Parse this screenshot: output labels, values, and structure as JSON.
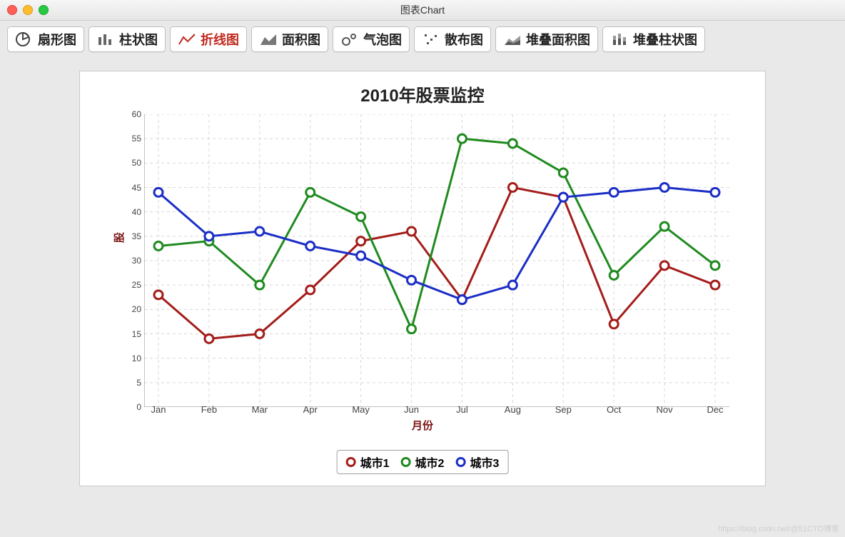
{
  "window": {
    "title": "图表Chart"
  },
  "toolbar": [
    {
      "label": "扇形图",
      "active": false
    },
    {
      "label": "柱状图",
      "active": false
    },
    {
      "label": "折线图",
      "active": true
    },
    {
      "label": "面积图",
      "active": false
    },
    {
      "label": "气泡图",
      "active": false
    },
    {
      "label": "散布图",
      "active": false
    },
    {
      "label": "堆叠面积图",
      "active": false
    },
    {
      "label": "堆叠柱状图",
      "active": false
    }
  ],
  "watermark": "https://blog.csdn.net/@51CTO博客",
  "chart_data": {
    "type": "line",
    "title": "2010年股票监控",
    "xlabel": "月份",
    "ylabel": "股",
    "categories": [
      "Jan",
      "Feb",
      "Mar",
      "Apr",
      "May",
      "Jun",
      "Jul",
      "Aug",
      "Sep",
      "Oct",
      "Nov",
      "Dec"
    ],
    "ylim": [
      0,
      60
    ],
    "yticks": [
      0,
      5,
      10,
      15,
      20,
      25,
      30,
      35,
      40,
      45,
      50,
      55,
      60
    ],
    "series": [
      {
        "name": "城市1",
        "color": "#a31d1a",
        "values": [
          23,
          14,
          15,
          24,
          34,
          36,
          22,
          45,
          43,
          17,
          29,
          25
        ]
      },
      {
        "name": "城市2",
        "color": "#1f8a1f",
        "values": [
          33,
          34,
          25,
          44,
          39,
          16,
          55,
          54,
          48,
          27,
          37,
          29
        ]
      },
      {
        "name": "城市3",
        "color": "#1b2ec5",
        "values": [
          44,
          35,
          36,
          33,
          31,
          26,
          22,
          25,
          43,
          44,
          45,
          44
        ]
      }
    ]
  }
}
